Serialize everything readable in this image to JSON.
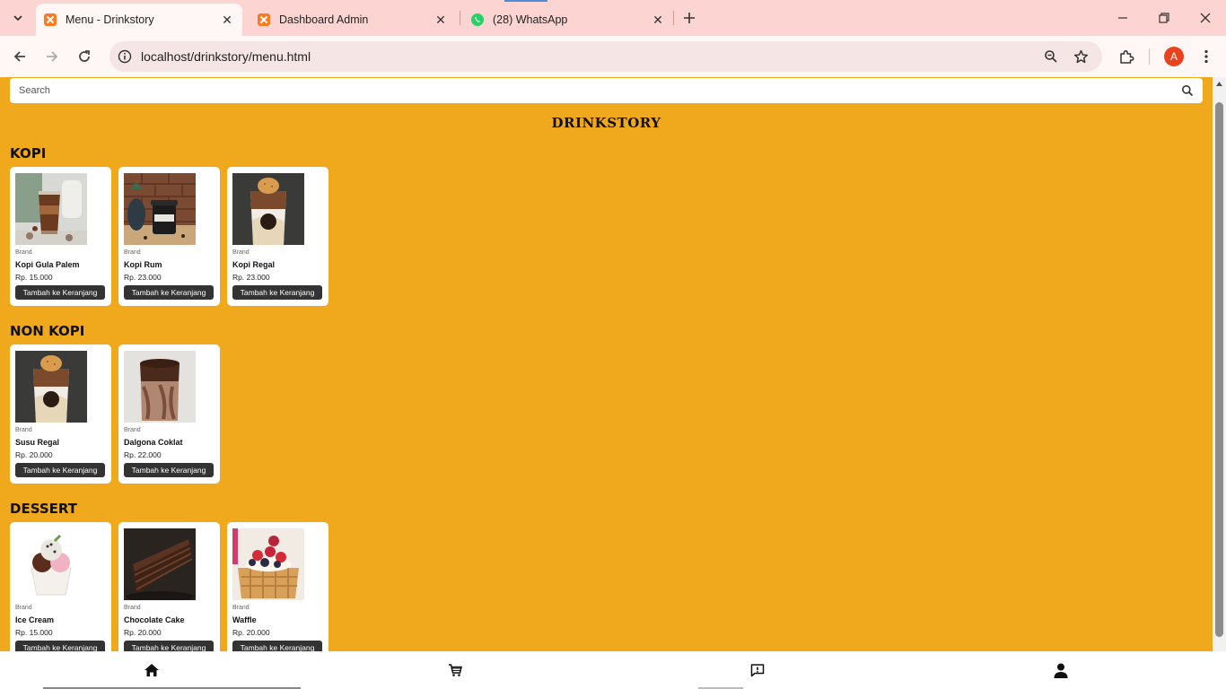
{
  "browser": {
    "tabs": [
      {
        "title": "Menu - Drinkstory",
        "active": true,
        "favicon": "xampp-icon"
      },
      {
        "title": "Dashboard Admin",
        "active": false,
        "favicon": "xampp-icon"
      },
      {
        "title": "(28) WhatsApp",
        "active": false,
        "favicon": "whatsapp-icon"
      }
    ],
    "url": "localhost/drinkstory/menu.html",
    "profile_initial": "A",
    "accent_color": "#e8431e"
  },
  "page": {
    "search_placeholder": "Search",
    "brand_title": "DRINKSTORY",
    "background_color": "#f0a81c",
    "sections": [
      {
        "title": "KOPI",
        "items": [
          {
            "brand": "Brand",
            "name": "Kopi Gula Palem",
            "price": "Rp. 15.000",
            "button": "Tambah ke Keranjang"
          },
          {
            "brand": "Brand",
            "name": "Kopi Rum",
            "price": "Rp. 23.000",
            "button": "Tambah ke Keranjang"
          },
          {
            "brand": "Brand",
            "name": "Kopi Regal",
            "price": "Rp. 23.000",
            "button": "Tambah ke Keranjang"
          }
        ]
      },
      {
        "title": "NON KOPI",
        "items": [
          {
            "brand": "Brand",
            "name": "Susu Regal",
            "price": "Rp. 20.000",
            "button": "Tambah ke Keranjang"
          },
          {
            "brand": "Brand",
            "name": "Dalgona Coklat",
            "price": "Rp. 22.000",
            "button": "Tambah ke Keranjang"
          }
        ]
      },
      {
        "title": "DESSERT",
        "items": [
          {
            "brand": "Brand",
            "name": "Ice Cream",
            "price": "Rp. 15.000",
            "button": "Tambah ke Keranjang"
          },
          {
            "brand": "Brand",
            "name": "Chocolate Cake",
            "price": "Rp. 20.000",
            "button": "Tambah ke Keranjang"
          },
          {
            "brand": "Brand",
            "name": "Waffle",
            "price": "Rp. 20.000",
            "button": "Tambah ke Keranjang"
          }
        ]
      }
    ]
  },
  "bottom_nav": [
    "home-icon",
    "cart-icon",
    "feedback-icon",
    "profile-icon"
  ]
}
